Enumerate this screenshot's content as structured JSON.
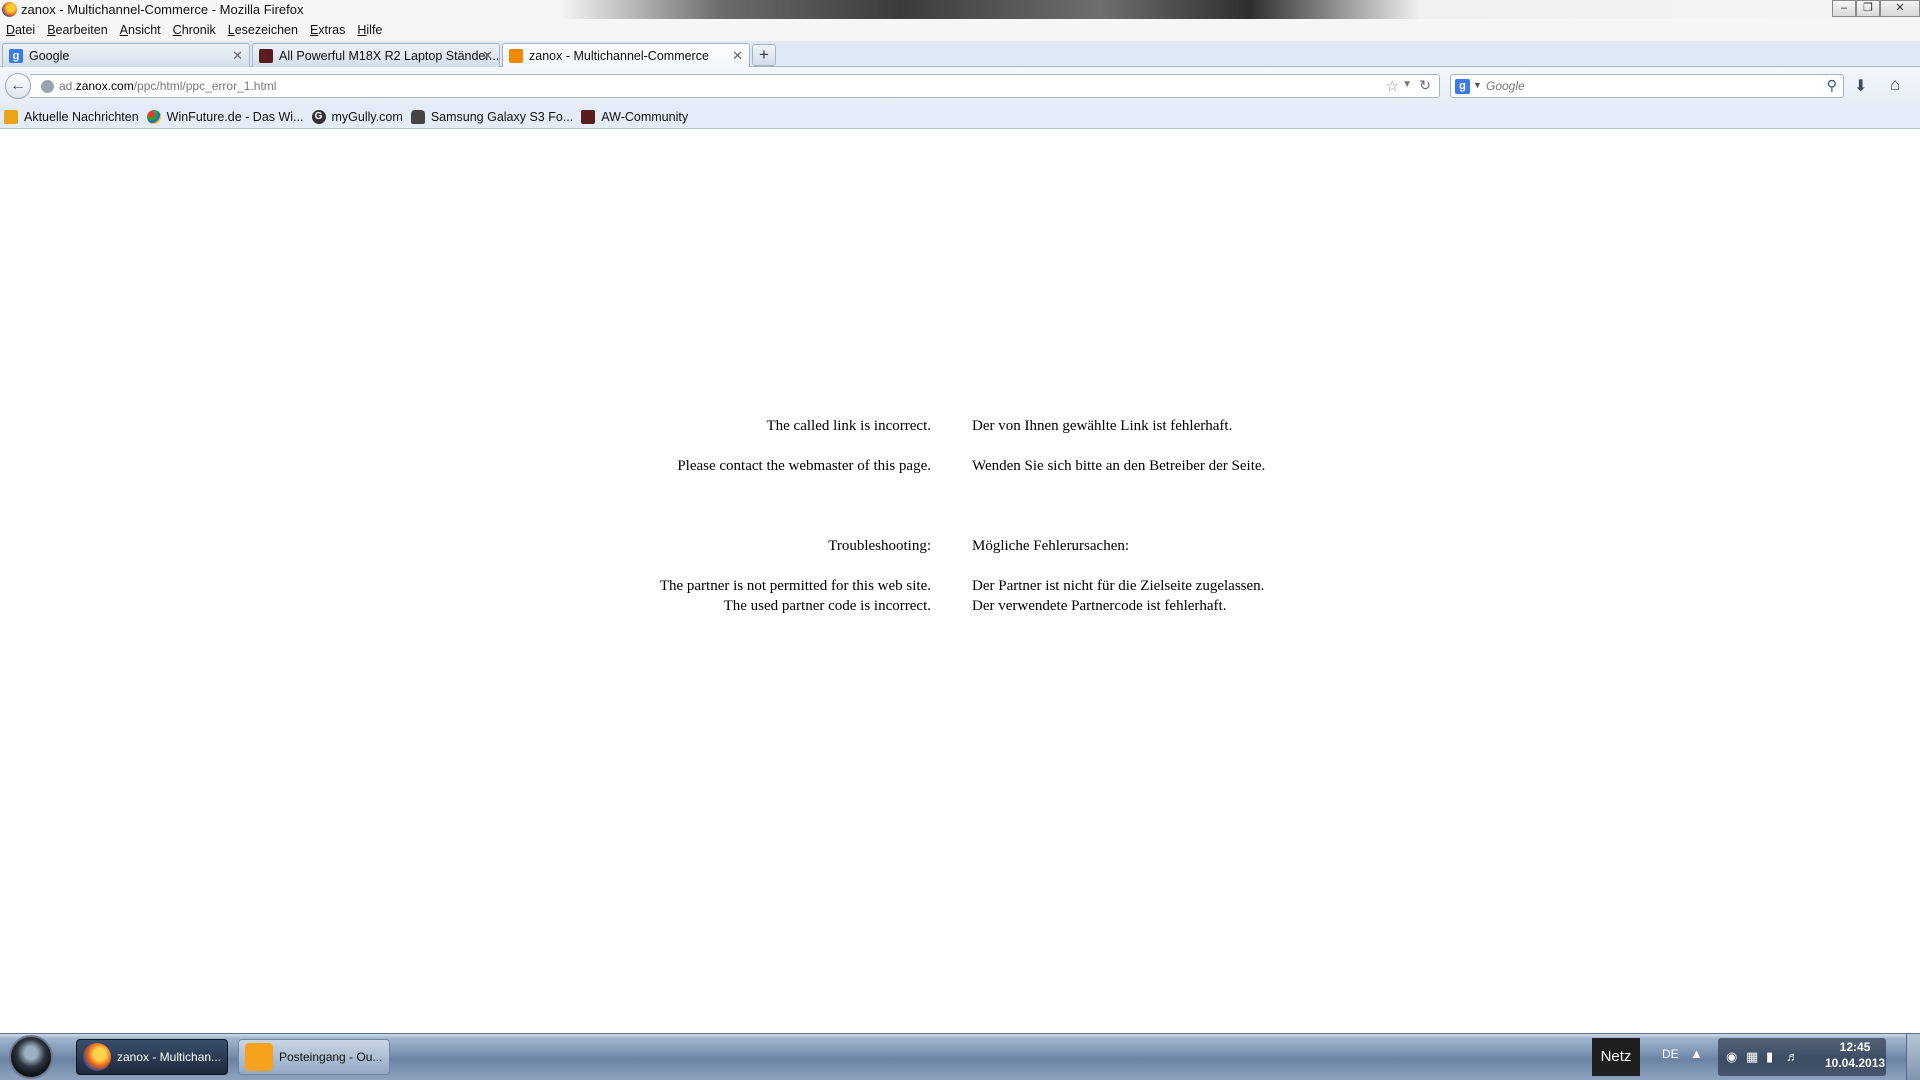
{
  "window": {
    "title": "zanox - Multichannel-Commerce - Mozilla Firefox"
  },
  "menubar": {
    "items": [
      "Datei",
      "Bearbeiten",
      "Ansicht",
      "Chronik",
      "Lesezeichen",
      "Extras",
      "Hilfe"
    ]
  },
  "tabs": [
    {
      "label": "Google",
      "icon": "google-icon",
      "active": false
    },
    {
      "label": "All Powerful M18X R2 Laptop Ständer...",
      "icon": "alienware-icon",
      "active": false
    },
    {
      "label": "zanox - Multichannel-Commerce",
      "icon": "zanox-icon",
      "active": true
    }
  ],
  "navbar": {
    "url_prefix": "ad.",
    "url_domain": "zanox.com",
    "url_path": "/ppc/html/ppc_error_1.html",
    "search_placeholder": "Google"
  },
  "bookmarks": [
    {
      "label": "Aktuelle Nachrichten",
      "icon": "feed-icon"
    },
    {
      "label": "WinFuture.de - Das Wi...",
      "icon": "winfuture-icon"
    },
    {
      "label": "myGully.com",
      "icon": "mygully-icon"
    },
    {
      "label": "Samsung Galaxy S3 Fo...",
      "icon": "android-icon"
    },
    {
      "label": "AW-Community",
      "icon": "alienware-icon"
    }
  ],
  "content": {
    "en_line1": "The called link is incorrect.",
    "en_line2": "Please contact the webmaster of this page.",
    "en_heading": "Troubleshooting:",
    "en_cause1": "The partner is not permitted for this web site.",
    "en_cause2": "The used partner code is incorrect.",
    "de_line1": "Der von Ihnen gewählte Link ist fehlerhaft.",
    "de_line2": "Wenden Sie sich bitte an den Betreiber der Seite.",
    "de_heading": "Mögliche Fehlerursachen:",
    "de_cause1": "Der Partner ist nicht für die Zielseite zugelassen.",
    "de_cause2": "Der verwendete Partnercode ist fehlerhaft."
  },
  "taskbar": {
    "tasks": [
      {
        "label": "zanox - Multichan...",
        "icon": "firefox-icon"
      },
      {
        "label": "Posteingang - Ou...",
        "icon": "outlook-icon"
      }
    ],
    "netz": "Netz",
    "language": "DE",
    "time": "12:45",
    "date": "10.04.2013"
  }
}
